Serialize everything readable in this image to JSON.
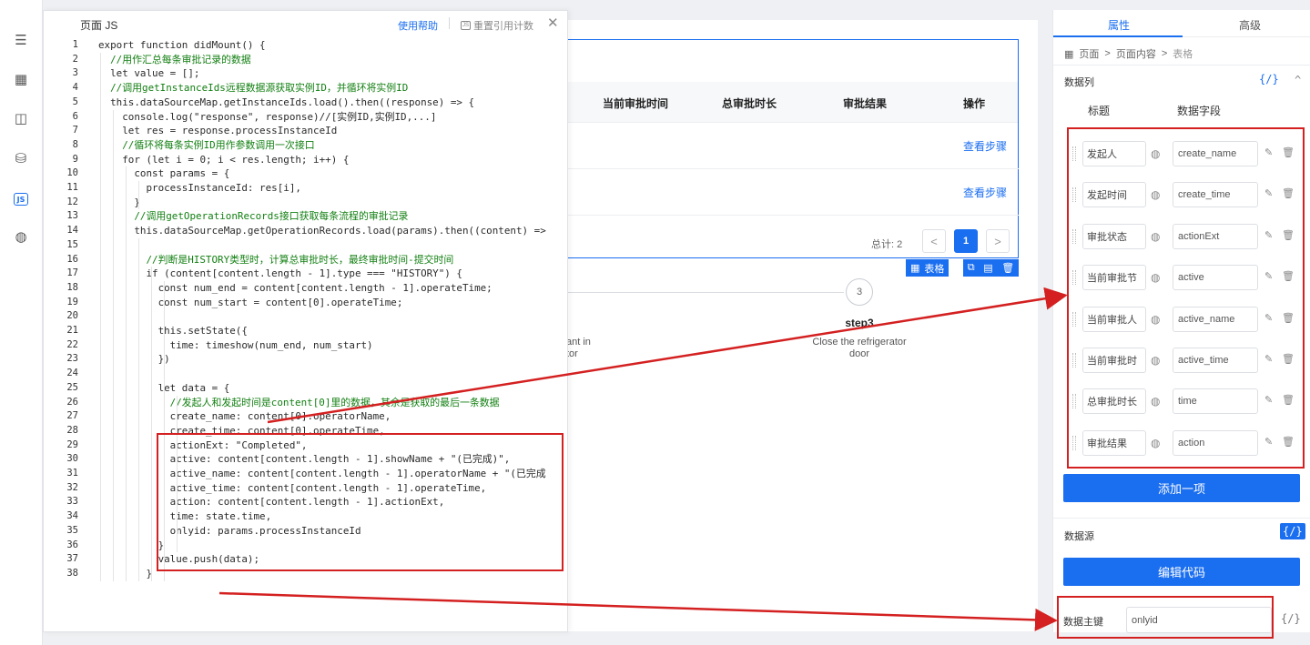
{
  "rail": {
    "icons": [
      "menu-icon",
      "grid-icon",
      "layout-icon",
      "database-icon",
      "js-icon",
      "globe-icon"
    ],
    "js_label": "JS"
  },
  "code_panel": {
    "title": "页面 JS",
    "help": "使用帮助",
    "reset": "重置引用计数",
    "close": "✕",
    "lines": [
      {
        "n": "1",
        "t": "export function didMount() {",
        "c": false
      },
      {
        "n": "2",
        "t": "  //用作汇总每条审批记录的数据",
        "c": true
      },
      {
        "n": "3",
        "t": "  let value = [];",
        "c": false
      },
      {
        "n": "4",
        "t": "  //调用getInstanceIds远程数据源获取实例ID，并循环将实例ID",
        "c": true
      },
      {
        "n": "5",
        "t": "  this.dataSourceMap.getInstanceIds.load().then((response) => {",
        "c": false
      },
      {
        "n": "6",
        "t": "    console.log(\"response\", response)//[实例ID,实例ID,...]",
        "c": false
      },
      {
        "n": "7",
        "t": "    let res = response.processInstanceId",
        "c": false
      },
      {
        "n": "8",
        "t": "    //循环将每条实例ID用作参数调用一次接口",
        "c": true
      },
      {
        "n": "9",
        "t": "    for (let i = 0; i < res.length; i++) {",
        "c": false
      },
      {
        "n": "10",
        "t": "      const params = {",
        "c": false
      },
      {
        "n": "11",
        "t": "        processInstanceId: res[i],",
        "c": false
      },
      {
        "n": "12",
        "t": "      }",
        "c": false
      },
      {
        "n": "13",
        "t": "      //调用getOperationRecords接口获取每条流程的审批记录",
        "c": true
      },
      {
        "n": "14",
        "t": "      this.dataSourceMap.getOperationRecords.load(params).then((content) =>",
        "c": false
      },
      {
        "n": "15",
        "t": "",
        "c": false
      },
      {
        "n": "16",
        "t": "        //判断是HISTORY类型时，计算总审批时长，最终审批时间-提交时间",
        "c": true
      },
      {
        "n": "17",
        "t": "        if (content[content.length - 1].type === \"HISTORY\") {",
        "c": false
      },
      {
        "n": "18",
        "t": "          const num_end = content[content.length - 1].operateTime;",
        "c": false
      },
      {
        "n": "19",
        "t": "          const num_start = content[0].operateTime;",
        "c": false
      },
      {
        "n": "20",
        "t": "",
        "c": false
      },
      {
        "n": "21",
        "t": "          this.setState({",
        "c": false
      },
      {
        "n": "22",
        "t": "            time: timeshow(num_end, num_start)",
        "c": false
      },
      {
        "n": "23",
        "t": "          })",
        "c": false
      },
      {
        "n": "24",
        "t": "",
        "c": false
      },
      {
        "n": "25",
        "t": "          let data = {",
        "c": false
      },
      {
        "n": "26",
        "t": "            //发起人和发起时间是content[0]里的数据，其余是获取的最后一条数据",
        "c": true
      },
      {
        "n": "27",
        "t": "            create_name: content[0].operatorName,",
        "c": false
      },
      {
        "n": "28",
        "t": "            create_time: content[0].operateTime,",
        "c": false
      },
      {
        "n": "29",
        "t": "            actionExt: \"Completed\",",
        "c": false
      },
      {
        "n": "30",
        "t": "            active: content[content.length - 1].showName + \"(已完成)\",",
        "c": false
      },
      {
        "n": "31",
        "t": "            active_name: content[content.length - 1].operatorName + \"(已完成",
        "c": false
      },
      {
        "n": "32",
        "t": "            active_time: content[content.length - 1].operateTime,",
        "c": false
      },
      {
        "n": "33",
        "t": "            action: content[content.length - 1].actionExt,",
        "c": false
      },
      {
        "n": "34",
        "t": "            time: state.time,",
        "c": false
      },
      {
        "n": "35",
        "t": "            onlyid: params.processInstanceId",
        "c": false
      },
      {
        "n": "36",
        "t": "          }",
        "c": false
      },
      {
        "n": "37",
        "t": "          value.push(data);",
        "c": false
      },
      {
        "n": "38",
        "t": "        }",
        "c": false
      }
    ]
  },
  "canvas": {
    "headers": [
      "当前审批时间",
      "总审批时长",
      "审批结果",
      "操作"
    ],
    "row_links": [
      "查看步骤",
      "查看步骤"
    ],
    "pager_total": "总计: 2",
    "pager_prev": "<",
    "pager_page": "1",
    "pager_next": ">",
    "table_tag": "表格",
    "step_num": "3",
    "step_title": "step3",
    "step_desc": "Close the refrigerator door",
    "step_frag": "ant in\ntor"
  },
  "right_panel": {
    "tab_props": "属性",
    "tab_adv": "高级",
    "crumbs": [
      "页面",
      "页面内容",
      "表格"
    ],
    "crumb_sep": ">",
    "section_cols": "数据列",
    "code_icon": "{/}",
    "collapse": "^",
    "col_title": "标题",
    "col_field": "数据字段",
    "fields": [
      {
        "title": "发起人",
        "field": "create_name"
      },
      {
        "title": "发起时间",
        "field": "create_time"
      },
      {
        "title": "审批状态",
        "field": "actionExt"
      },
      {
        "title": "当前审批节",
        "field": "active"
      },
      {
        "title": "当前审批人",
        "field": "active_name"
      },
      {
        "title": "当前审批时",
        "field": "active_time"
      },
      {
        "title": "总审批时长",
        "field": "time"
      },
      {
        "title": "审批结果",
        "field": "action"
      }
    ],
    "add_btn": "添加一项",
    "section_ds": "数据源",
    "edit_btn": "编辑代码",
    "pk_label": "数据主键",
    "pk_value": "onlyid"
  },
  "colors": {
    "accent": "#1a6ef0",
    "annotation": "#d42020"
  }
}
